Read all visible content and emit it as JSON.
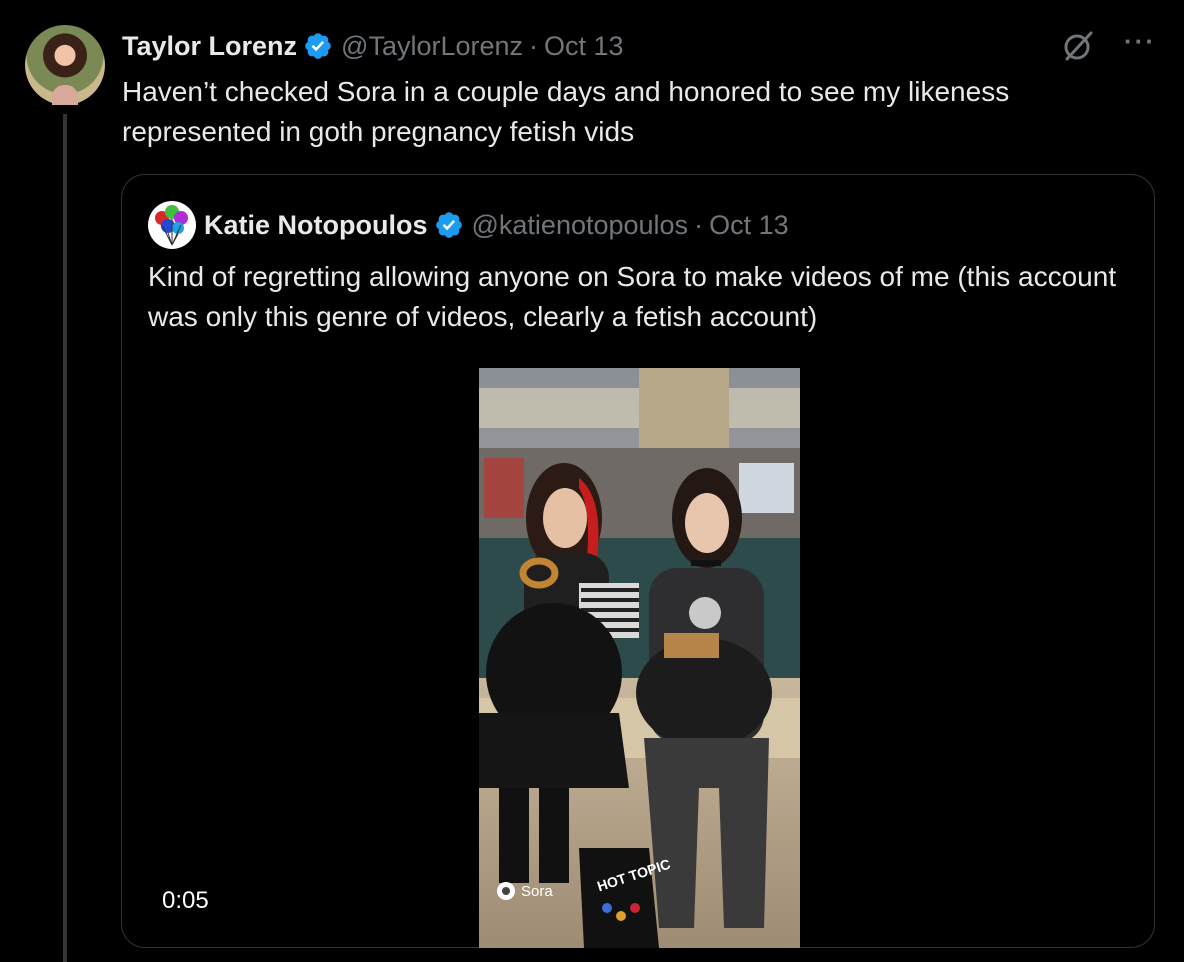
{
  "tweet": {
    "author_name": "Taylor Lorenz",
    "handle": "@TaylorLorenz",
    "separator": "·",
    "date": "Oct 13",
    "text": "Haven’t checked Sora in a couple days and honored to see my likeness represented in goth pregnancy fetish vids",
    "more_label": "···",
    "grok_icon": "grok-icon"
  },
  "quoted_tweet": {
    "author_name": "Katie Notopoulos",
    "handle": "@katienotopoulos",
    "separator": "·",
    "date": "Oct 13",
    "text": "Kind of regretting allowing anyone on Sora to make videos of me (this account was only this genre of videos, clearly a fetish account)",
    "video": {
      "duration": "0:05",
      "watermark": "Sora",
      "bag_text": "HOT TOPIC"
    }
  },
  "colors": {
    "background": "#000000",
    "text": "#e7e9ea",
    "muted": "#71767b",
    "verified": "#1d9bf0",
    "border": "#2f3336"
  }
}
